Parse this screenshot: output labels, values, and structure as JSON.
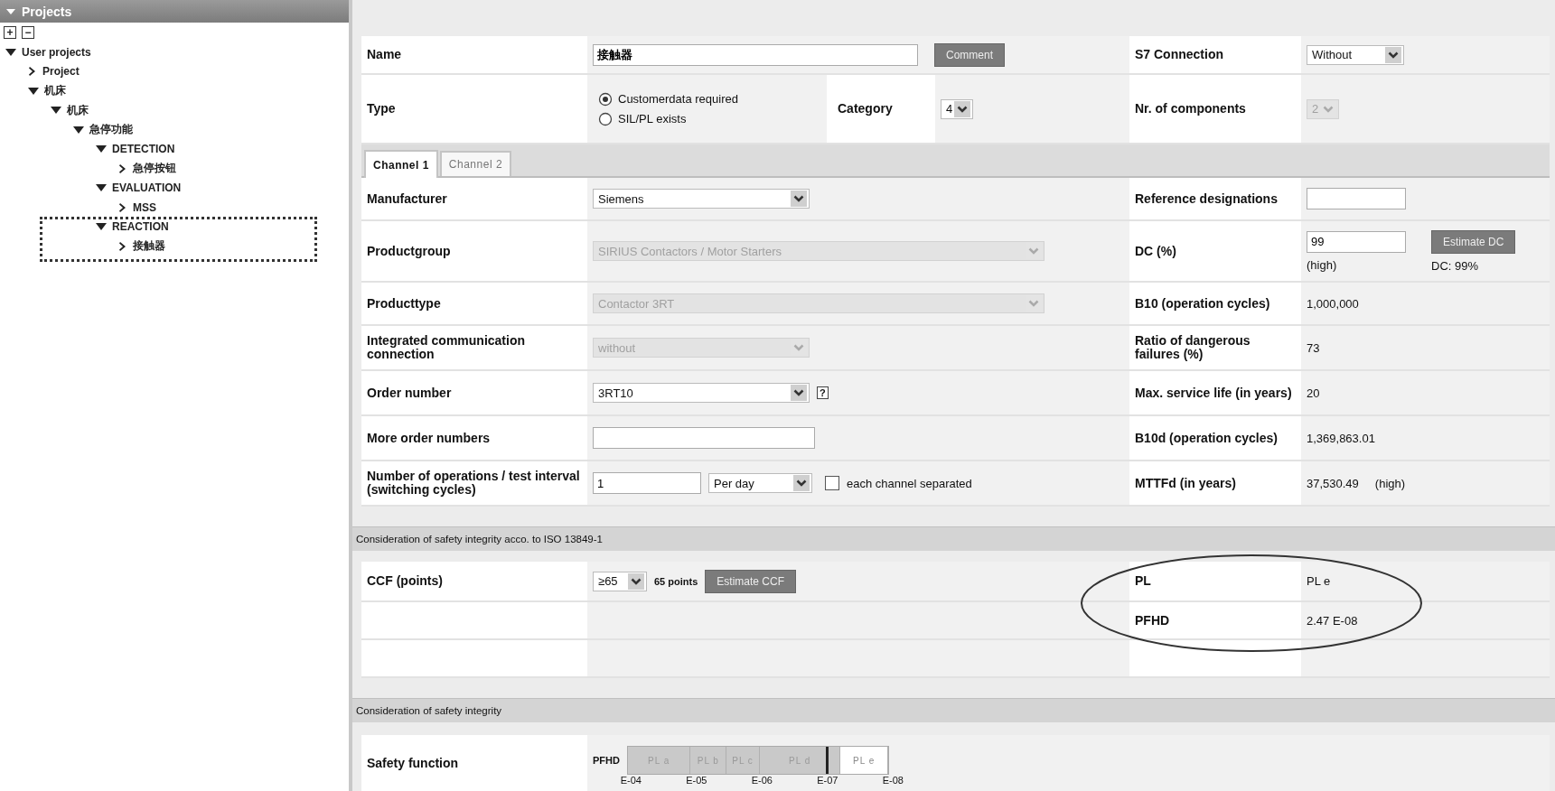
{
  "sidebar": {
    "title": "Projects",
    "expanded": true,
    "tools": [
      "+",
      "−"
    ],
    "tree": [
      {
        "label": "User projects",
        "expanded": true,
        "children": [
          {
            "label": "Project",
            "expanded": false
          },
          {
            "label": "机床",
            "expanded": true,
            "children": [
              {
                "label": "机床",
                "expanded": true,
                "children": [
                  {
                    "label": "急停功能",
                    "expanded": true,
                    "children": [
                      {
                        "label": "DETECTION",
                        "expanded": true,
                        "children": [
                          {
                            "label": "急停按钮",
                            "expanded": false
                          }
                        ]
                      },
                      {
                        "label": "EVALUATION",
                        "expanded": true,
                        "children": [
                          {
                            "label": "MSS",
                            "expanded": false
                          }
                        ]
                      },
                      {
                        "label": "REACTION",
                        "expanded": true,
                        "children": [
                          {
                            "label": "接触器",
                            "expanded": false
                          }
                        ]
                      }
                    ]
                  }
                ]
              }
            ]
          }
        ]
      }
    ]
  },
  "component": {
    "name": {
      "label": "Name",
      "value": "接触器",
      "button": "Comment"
    },
    "s7": {
      "label": "S7 Connection",
      "value": "Without",
      "disabled": false
    },
    "type": {
      "label": "Type",
      "options": [
        {
          "label": "Customerdata required",
          "selected": true
        },
        {
          "label": "SIL/PL exists",
          "selected": false
        }
      ]
    },
    "category": {
      "label": "Category",
      "value": "4",
      "disabled": false
    },
    "components": {
      "label": "Nr. of components",
      "value": "2",
      "disabled": true
    }
  },
  "tabs": [
    {
      "label": "Channel 1",
      "selected": true
    },
    {
      "label": "Channel 2",
      "selected": false
    }
  ],
  "channel_left": [
    {
      "kind": "select",
      "label": "Manufacturer",
      "value": "Siemens",
      "disabled": false
    },
    {
      "kind": "wide_select",
      "label": "Productgroup",
      "value": "SIRIUS Contactors / Motor Starters",
      "disabled": true
    },
    {
      "kind": "wide_select",
      "label": "Producttype",
      "value": "Contactor 3RT",
      "disabled": true
    },
    {
      "kind": "select",
      "label": "Integrated communication connection",
      "value": "without",
      "disabled": true
    },
    {
      "kind": "select",
      "label": "Order number",
      "value": "3RT10",
      "disabled": false,
      "help": "?"
    },
    {
      "kind": "input",
      "label": "More order numbers"
    },
    {
      "kind": "interval",
      "label": "Number of operations / test interval (switching cycles)",
      "value": "1",
      "unit": {
        "value": "Per day",
        "disabled": false
      },
      "checkbox": {
        "label": "each channel separated",
        "checked": false
      }
    }
  ],
  "channel_right": [
    {
      "kind": "input",
      "label": "Reference designations"
    },
    {
      "kind": "estimate",
      "label": "DC (%)",
      "value": "99",
      "note": "(high)",
      "button": "Estimate DC",
      "result": "DC: 99%"
    },
    {
      "kind": "text",
      "label": "B10 (operation cycles)",
      "value": "1,000,000"
    },
    {
      "kind": "text",
      "label": "Ratio of dangerous failures (%)",
      "value": "73"
    },
    {
      "kind": "text",
      "label": "Max. service life (in years)",
      "value": "20"
    },
    {
      "kind": "text",
      "label": "B10d (operation cycles)",
      "value": "1,369,863.01"
    },
    {
      "kind": "text",
      "label": "MTTFd (in years)",
      "value": "37,530.49",
      "note": "(high)"
    }
  ],
  "iso_section": {
    "title": "Consideration of safety integrity acco. to ISO 13849-1",
    "ccf": {
      "label": "CCF (points)",
      "value": "≥65",
      "disabled": false,
      "points": "65 points",
      "button": "Estimate CCF"
    },
    "results": [
      {
        "label": "PL",
        "value": "PL e"
      },
      {
        "label": "PFHD",
        "value": "2.47 E-08"
      }
    ]
  },
  "integrity_section": {
    "title": "Consideration of safety integrity",
    "label": "Safety function",
    "scale": {
      "label": "PFHD",
      "level": 0.76,
      "segments": [
        {
          "label": "PL a",
          "selected": false
        },
        {
          "label": "PL b",
          "selected": false
        },
        {
          "label": "PL c",
          "selected": false
        },
        {
          "label": "PL d",
          "selected": false
        },
        {
          "label": "PL e",
          "selected": true
        }
      ],
      "ticks": [
        "E-04",
        "E-05",
        "E-06",
        "E-07",
        "E-08"
      ]
    }
  }
}
